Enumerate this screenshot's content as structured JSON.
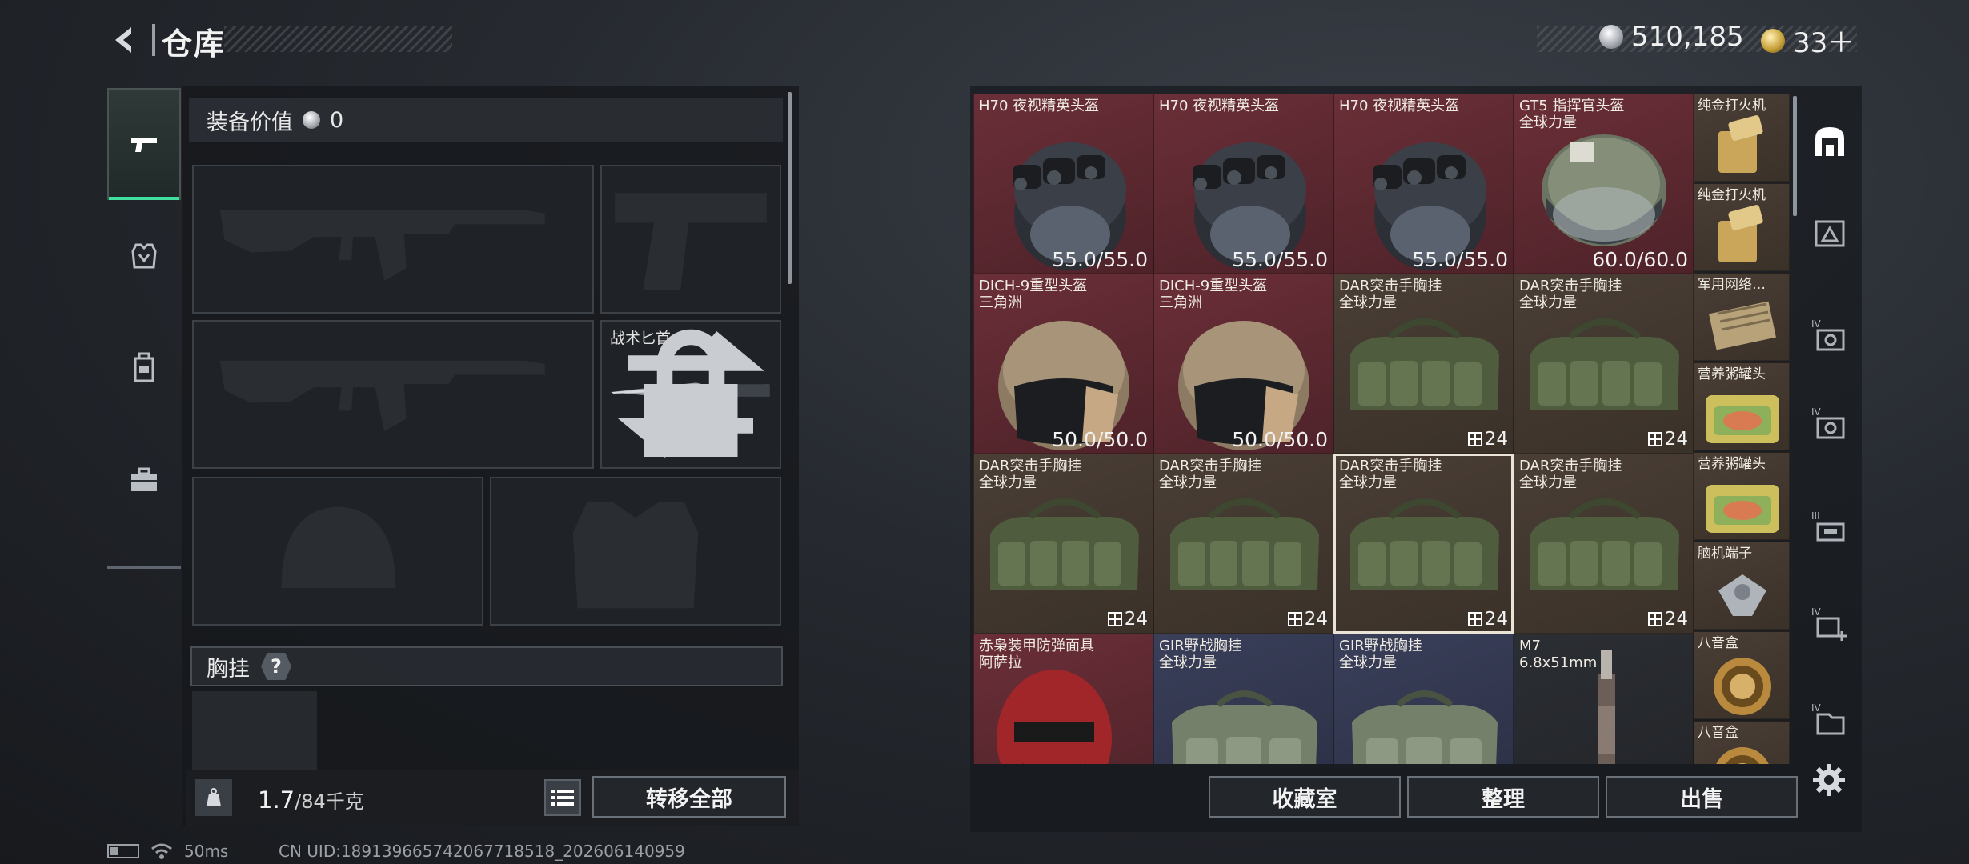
{
  "header": {
    "title": "仓库"
  },
  "currency": {
    "silver": "510,185",
    "gold": "33＋"
  },
  "equipment": {
    "value_label": "装备价值",
    "value": "0",
    "knife_slot_label": "战术匕首",
    "chest_rig_header": "胸挂",
    "help": "?"
  },
  "weight": {
    "current": "1.7",
    "max": "/84千克"
  },
  "buttons": {
    "transfer_all": "转移全部",
    "collection": "收藏室",
    "organize": "整理",
    "sell": "出售"
  },
  "items": [
    {
      "name": [
        "H70 夜视精英头盔"
      ],
      "badge": "55.0/55.0"
    },
    {
      "name": [
        "H70 夜视精英头盔"
      ],
      "badge": "55.0/55.0"
    },
    {
      "name": [
        "H70 夜视精英头盔"
      ],
      "badge": "55.0/55.0"
    },
    {
      "name": [
        "GT5 指挥官头盔",
        "全球力量"
      ],
      "badge": "60.0/60.0"
    },
    {
      "name": [
        "DICH-9重型头盔",
        "三角洲"
      ],
      "badge": "50.0/50.0"
    },
    {
      "name": [
        "DICH-9重型头盔",
        "三角洲"
      ],
      "badge": "50.0/50.0"
    },
    {
      "name": [
        "DAR突击手胸挂",
        "全球力量"
      ],
      "badge": "24"
    },
    {
      "name": [
        "DAR突击手胸挂",
        "全球力量"
      ],
      "badge": "24"
    },
    {
      "name": [
        "DAR突击手胸挂",
        "全球力量"
      ],
      "badge": "24"
    },
    {
      "name": [
        "DAR突击手胸挂",
        "全球力量"
      ],
      "badge": "24"
    },
    {
      "name": [
        "DAR突击手胸挂",
        "全球力量"
      ],
      "badge": "24"
    },
    {
      "name": [
        "DAR突击手胸挂",
        "全球力量"
      ],
      "badge": "24"
    },
    {
      "name": [
        "赤枭装甲防弹面具",
        "阿萨拉"
      ],
      "badge": ""
    },
    {
      "name": [
        "GIR野战胸挂",
        "全球力量"
      ],
      "badge": ""
    },
    {
      "name": [
        "GIR野战胸挂",
        "全球力量"
      ],
      "badge": ""
    },
    {
      "name": [
        "M7",
        "6.8x51mm"
      ],
      "badge": ""
    }
  ],
  "small_items": [
    {
      "name": "纯金打火机"
    },
    {
      "name": "纯金打火机"
    },
    {
      "name": "军用网络…"
    },
    {
      "name": "营养粥罐头"
    },
    {
      "name": "营养粥罐头"
    },
    {
      "name": "脑机端子"
    },
    {
      "name": "八音盒"
    },
    {
      "name": "八音盒"
    }
  ],
  "category_tabs": [
    "home-icon",
    "warehouse-I-icon",
    "warehouse-IV-icon",
    "warehouse-IV-icon",
    "warehouse-III-icon",
    "warehouse-IV-add-icon",
    "warehouse-IV-icon"
  ],
  "status": {
    "ping": "50ms",
    "uid": "CN UID:18913966574206771851​8_202606140959"
  }
}
